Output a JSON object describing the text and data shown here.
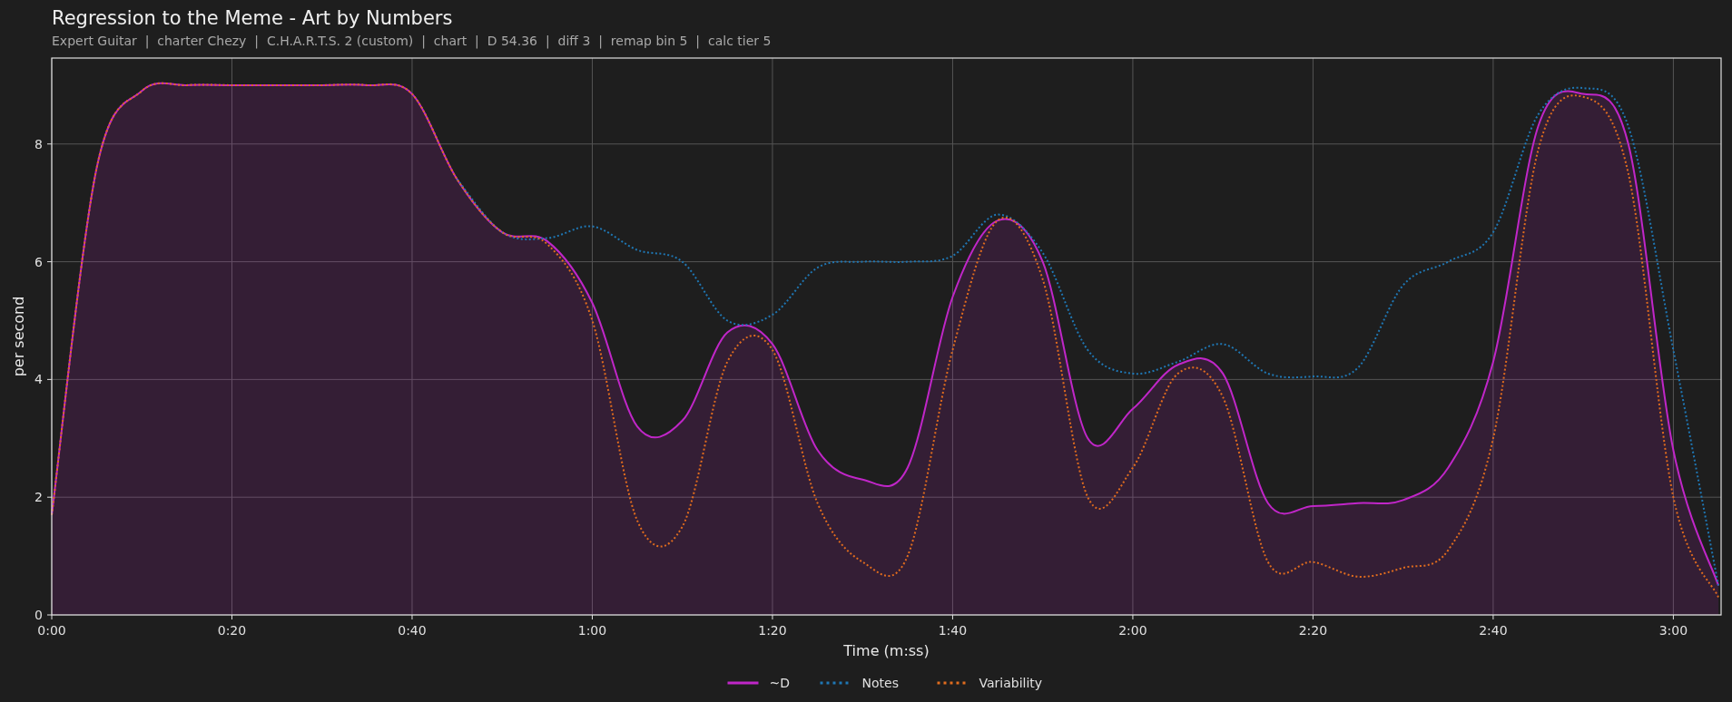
{
  "title": "Regression to the Meme - Art by Numbers",
  "subtitle": "Expert Guitar  |  charter Chezy  |  C.H.A.R.T.S. 2 (custom)  |  chart  |  D 54.36  |  diff 3  |  remap bin 5  |  calc tier 5",
  "chart": {
    "chart_data": {
      "type": "line",
      "xlabel": "Time (m:ss)",
      "ylabel": "per second",
      "grid": true,
      "legend": "bottom",
      "x": [
        0,
        5,
        10,
        15,
        20,
        25,
        30,
        35,
        40,
        45,
        50,
        55,
        60,
        65,
        70,
        75,
        80,
        85,
        90,
        95,
        100,
        105,
        110,
        115,
        120,
        125,
        130,
        135,
        140,
        145,
        150,
        155,
        160,
        165,
        170,
        175,
        180,
        185
      ],
      "series": [
        {
          "name": "~D",
          "color": "#c026c8",
          "line_style": "solid",
          "type": "area",
          "values": [
            1.7,
            7.6,
            8.9,
            9.0,
            9.0,
            9.0,
            9.0,
            9.0,
            8.85,
            7.4,
            6.5,
            6.35,
            5.3,
            3.2,
            3.3,
            4.8,
            4.6,
            2.8,
            2.3,
            2.5,
            5.4,
            6.7,
            6.0,
            3.0,
            3.5,
            4.25,
            4.1,
            1.9,
            1.85,
            1.9,
            1.95,
            2.5,
            4.3,
            8.3,
            8.85,
            8.0,
            2.8,
            0.5
          ]
        },
        {
          "name": "Notes",
          "color": "#1f77b4",
          "line_style": "dotted",
          "type": "line",
          "values": [
            null,
            null,
            null,
            null,
            null,
            null,
            null,
            null,
            null,
            7.4,
            6.5,
            6.4,
            6.6,
            6.2,
            6.0,
            5.0,
            5.1,
            5.9,
            6.0,
            6.0,
            6.1,
            6.8,
            6.15,
            4.5,
            4.1,
            4.3,
            4.6,
            4.1,
            4.05,
            4.2,
            5.6,
            6.0,
            6.5,
            8.5,
            8.95,
            8.3,
            4.5,
            0.5
          ]
        },
        {
          "name": "Variability",
          "color": "#e06c1e",
          "line_style": "dotted",
          "type": "line",
          "values": [
            1.7,
            7.6,
            8.9,
            9.0,
            9.0,
            9.0,
            9.0,
            9.0,
            8.85,
            7.4,
            6.5,
            6.3,
            5.0,
            1.6,
            1.5,
            4.3,
            4.5,
            1.9,
            0.9,
            1.0,
            4.5,
            6.7,
            5.7,
            2.0,
            2.5,
            4.1,
            3.7,
            0.9,
            0.9,
            0.65,
            0.8,
            1.1,
            3.0,
            7.9,
            8.8,
            7.5,
            2.0,
            0.3
          ]
        }
      ],
      "xlim": [
        0,
        185.3
      ],
      "ylim": [
        0,
        9.46
      ],
      "xticks": [
        {
          "value": 0,
          "label": "0:00"
        },
        {
          "value": 20,
          "label": "0:20"
        },
        {
          "value": 40,
          "label": "0:40"
        },
        {
          "value": 60,
          "label": "1:00"
        },
        {
          "value": 80,
          "label": "1:20"
        },
        {
          "value": 100,
          "label": "1:40"
        },
        {
          "value": 120,
          "label": "2:00"
        },
        {
          "value": 140,
          "label": "2:20"
        },
        {
          "value": 160,
          "label": "2:40"
        },
        {
          "value": 180,
          "label": "3:00"
        }
      ],
      "yticks": [
        0,
        2,
        4,
        6,
        8
      ]
    }
  }
}
